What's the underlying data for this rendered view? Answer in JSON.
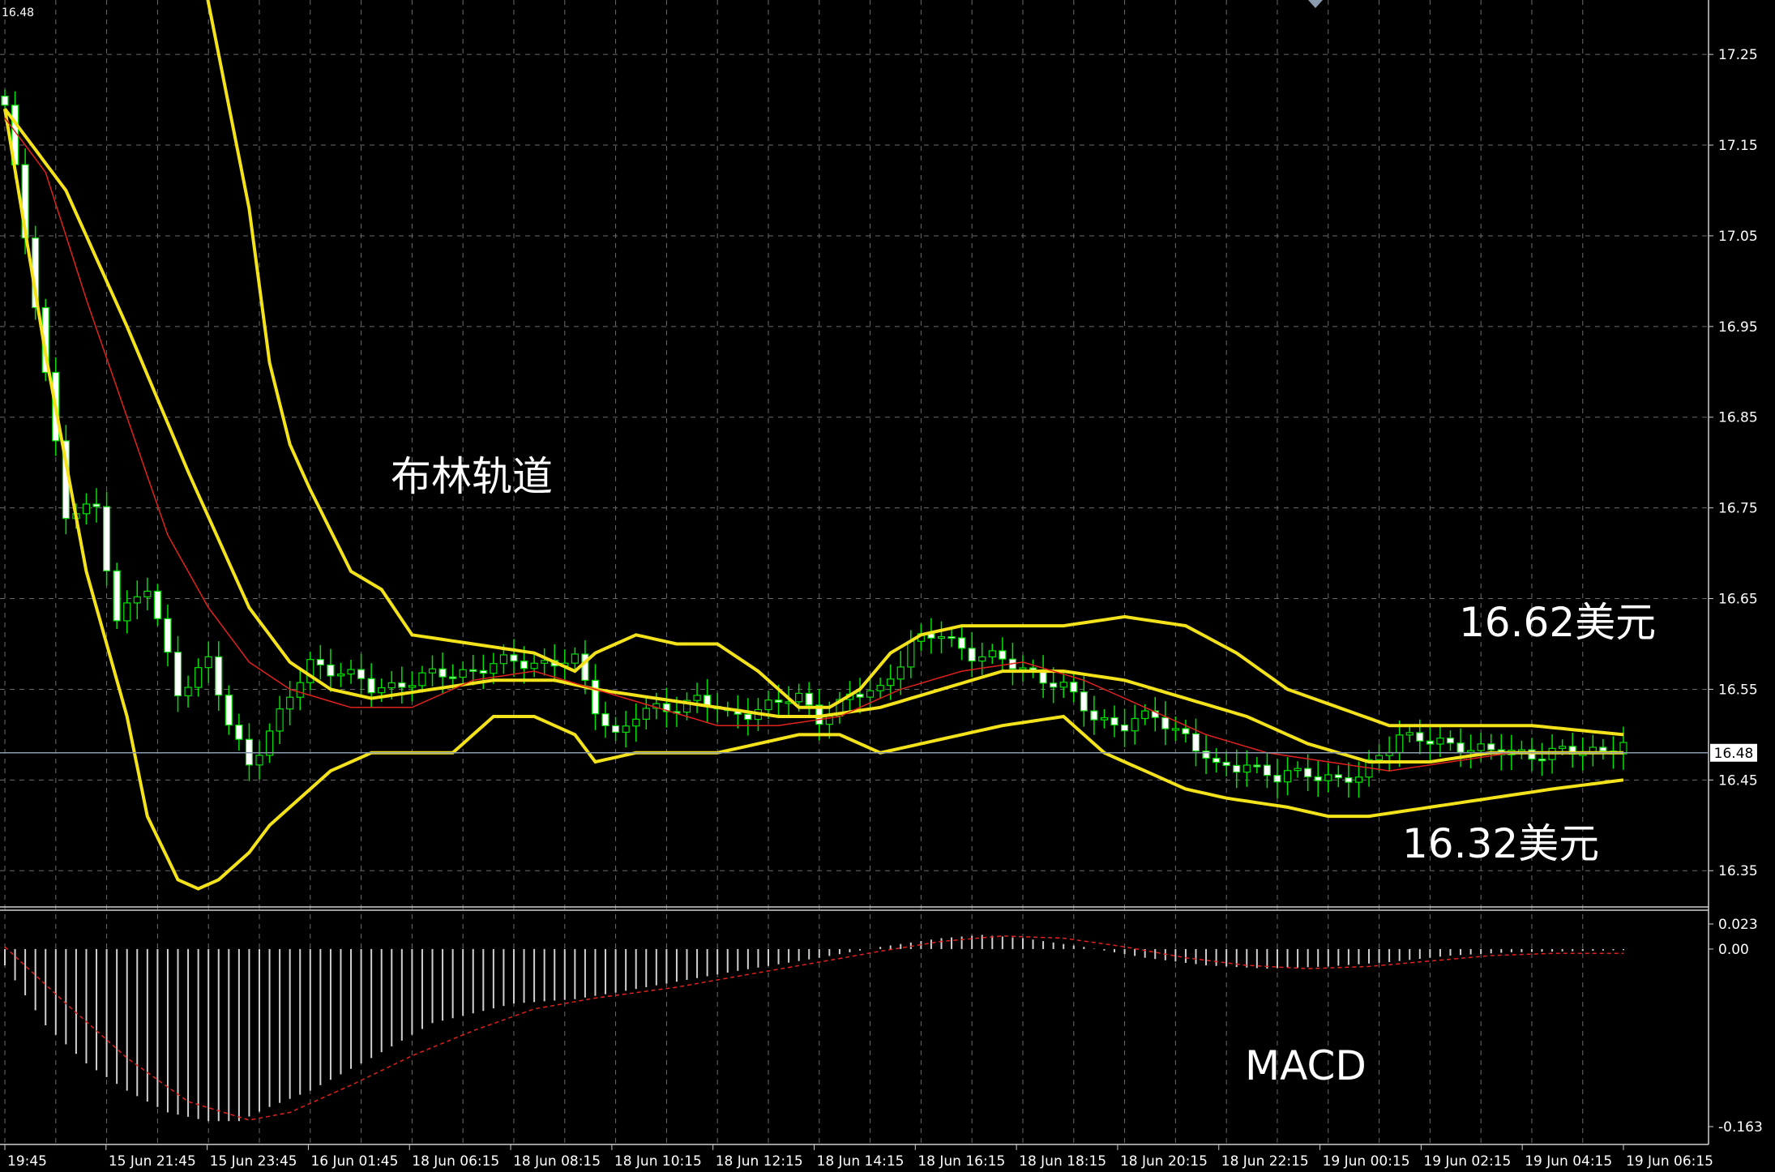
{
  "chart_data": {
    "type": "candlestick",
    "corner_price": "16.48",
    "current_price_label": "16.48",
    "current_price": 16.48,
    "price_axis": {
      "ylim": [
        16.31,
        17.31
      ],
      "ticks": [
        "17.25",
        "17.15",
        "17.05",
        "16.95",
        "16.85",
        "16.75",
        "16.65",
        "16.55",
        "16.45",
        "16.35"
      ],
      "tick_values": [
        17.25,
        17.15,
        17.05,
        16.95,
        16.85,
        16.75,
        16.65,
        16.55,
        16.45,
        16.35
      ]
    },
    "macd_axis": {
      "ylim": [
        -0.163,
        0.023
      ],
      "ticks": [
        "0.023",
        "0.00",
        "-0.163"
      ],
      "tick_values": [
        0.023,
        0.0,
        -0.163
      ]
    },
    "x_ticks": [
      "19:45",
      "15 Jun 21:45",
      "15 Jun 23:45",
      "16 Jun 01:45",
      "18 Jun 06:15",
      "18 Jun 08:15",
      "18 Jun 10:15",
      "18 Jun 12:15",
      "18 Jun 14:15",
      "18 Jun 16:15",
      "18 Jun 18:15",
      "18 Jun 20:15",
      "18 Jun 22:15",
      "19 Jun 00:15",
      "19 Jun 02:15",
      "19 Jun 04:15",
      "19 Jun 06:15"
    ],
    "bars_count": 160,
    "close_anchors": [
      [
        0,
        17.19
      ],
      [
        3,
        16.98
      ],
      [
        6,
        16.74
      ],
      [
        9,
        16.75
      ],
      [
        11,
        16.63
      ],
      [
        14,
        16.66
      ],
      [
        17,
        16.55
      ],
      [
        20,
        16.58
      ],
      [
        22,
        16.51
      ],
      [
        24,
        16.47
      ],
      [
        27,
        16.52
      ],
      [
        30,
        16.58
      ],
      [
        33,
        16.57
      ],
      [
        36,
        16.55
      ],
      [
        40,
        16.56
      ],
      [
        45,
        16.57
      ],
      [
        50,
        16.58
      ],
      [
        56,
        16.58
      ],
      [
        58,
        16.53
      ],
      [
        60,
        16.5
      ],
      [
        62,
        16.52
      ],
      [
        65,
        16.53
      ],
      [
        68,
        16.54
      ],
      [
        71,
        16.52
      ],
      [
        74,
        16.53
      ],
      [
        78,
        16.54
      ],
      [
        80,
        16.52
      ],
      [
        83,
        16.54
      ],
      [
        86,
        16.55
      ],
      [
        89,
        16.6
      ],
      [
        92,
        16.61
      ],
      [
        95,
        16.59
      ],
      [
        98,
        16.58
      ],
      [
        101,
        16.57
      ],
      [
        104,
        16.55
      ],
      [
        107,
        16.52
      ],
      [
        110,
        16.51
      ],
      [
        113,
        16.52
      ],
      [
        116,
        16.5
      ],
      [
        119,
        16.46
      ],
      [
        122,
        16.47
      ],
      [
        125,
        16.45
      ],
      [
        128,
        16.46
      ],
      [
        131,
        16.45
      ],
      [
        133,
        16.45
      ],
      [
        135,
        16.48
      ],
      [
        137,
        16.5
      ],
      [
        140,
        16.49
      ],
      [
        143,
        16.49
      ],
      [
        146,
        16.48
      ],
      [
        150,
        16.48
      ],
      [
        155,
        16.48
      ],
      [
        159,
        16.49
      ]
    ],
    "bollinger_upper_anchors": [
      [
        0,
        17.4
      ],
      [
        10,
        17.5
      ],
      [
        18,
        17.42
      ],
      [
        24,
        17.08
      ],
      [
        26,
        16.91
      ],
      [
        28,
        16.82
      ],
      [
        30,
        16.77
      ],
      [
        34,
        16.68
      ],
      [
        37,
        16.66
      ],
      [
        40,
        16.61
      ],
      [
        46,
        16.6
      ],
      [
        52,
        16.59
      ],
      [
        56,
        16.57
      ],
      [
        58,
        16.59
      ],
      [
        62,
        16.61
      ],
      [
        66,
        16.6
      ],
      [
        70,
        16.6
      ],
      [
        74,
        16.57
      ],
      [
        78,
        16.53
      ],
      [
        81,
        16.53
      ],
      [
        84,
        16.55
      ],
      [
        87,
        16.59
      ],
      [
        90,
        16.61
      ],
      [
        94,
        16.62
      ],
      [
        98,
        16.62
      ],
      [
        104,
        16.62
      ],
      [
        110,
        16.63
      ],
      [
        116,
        16.62
      ],
      [
        121,
        16.59
      ],
      [
        126,
        16.55
      ],
      [
        131,
        16.53
      ],
      [
        136,
        16.51
      ],
      [
        142,
        16.51
      ],
      [
        150,
        16.51
      ],
      [
        159,
        16.5
      ]
    ],
    "bollinger_middle_anchors": [
      [
        0,
        17.19
      ],
      [
        6,
        17.1
      ],
      [
        12,
        16.95
      ],
      [
        18,
        16.79
      ],
      [
        24,
        16.64
      ],
      [
        28,
        16.58
      ],
      [
        32,
        16.55
      ],
      [
        36,
        16.54
      ],
      [
        42,
        16.55
      ],
      [
        48,
        16.56
      ],
      [
        54,
        16.56
      ],
      [
        58,
        16.55
      ],
      [
        64,
        16.54
      ],
      [
        70,
        16.53
      ],
      [
        76,
        16.52
      ],
      [
        80,
        16.52
      ],
      [
        86,
        16.53
      ],
      [
        92,
        16.55
      ],
      [
        98,
        16.57
      ],
      [
        104,
        16.57
      ],
      [
        110,
        16.56
      ],
      [
        116,
        16.54
      ],
      [
        122,
        16.52
      ],
      [
        128,
        16.49
      ],
      [
        134,
        16.47
      ],
      [
        140,
        16.47
      ],
      [
        146,
        16.48
      ],
      [
        152,
        16.48
      ],
      [
        159,
        16.48
      ]
    ],
    "bollinger_lower_anchors": [
      [
        0,
        17.19
      ],
      [
        4,
        16.92
      ],
      [
        8,
        16.68
      ],
      [
        12,
        16.52
      ],
      [
        14,
        16.41
      ],
      [
        17,
        16.34
      ],
      [
        19,
        16.33
      ],
      [
        21,
        16.34
      ],
      [
        24,
        16.37
      ],
      [
        26,
        16.4
      ],
      [
        28,
        16.42
      ],
      [
        30,
        16.44
      ],
      [
        32,
        16.46
      ],
      [
        36,
        16.48
      ],
      [
        40,
        16.48
      ],
      [
        44,
        16.48
      ],
      [
        48,
        16.52
      ],
      [
        52,
        16.52
      ],
      [
        56,
        16.5
      ],
      [
        58,
        16.47
      ],
      [
        62,
        16.48
      ],
      [
        66,
        16.48
      ],
      [
        70,
        16.48
      ],
      [
        74,
        16.49
      ],
      [
        78,
        16.5
      ],
      [
        82,
        16.5
      ],
      [
        86,
        16.48
      ],
      [
        90,
        16.49
      ],
      [
        94,
        16.5
      ],
      [
        98,
        16.51
      ],
      [
        104,
        16.52
      ],
      [
        108,
        16.48
      ],
      [
        112,
        16.46
      ],
      [
        116,
        16.44
      ],
      [
        120,
        16.43
      ],
      [
        126,
        16.42
      ],
      [
        130,
        16.41
      ],
      [
        134,
        16.41
      ],
      [
        140,
        16.42
      ],
      [
        146,
        16.43
      ],
      [
        152,
        16.44
      ],
      [
        159,
        16.45
      ]
    ],
    "ma_anchors": [
      [
        0,
        17.18
      ],
      [
        4,
        17.12
      ],
      [
        8,
        16.98
      ],
      [
        12,
        16.85
      ],
      [
        16,
        16.72
      ],
      [
        20,
        16.64
      ],
      [
        24,
        16.58
      ],
      [
        28,
        16.55
      ],
      [
        34,
        16.53
      ],
      [
        40,
        16.53
      ],
      [
        46,
        16.56
      ],
      [
        52,
        16.57
      ],
      [
        58,
        16.55
      ],
      [
        64,
        16.53
      ],
      [
        70,
        16.51
      ],
      [
        76,
        16.51
      ],
      [
        82,
        16.52
      ],
      [
        88,
        16.55
      ],
      [
        94,
        16.57
      ],
      [
        100,
        16.58
      ],
      [
        106,
        16.56
      ],
      [
        112,
        16.53
      ],
      [
        118,
        16.5
      ],
      [
        124,
        16.48
      ],
      [
        130,
        16.47
      ],
      [
        136,
        16.46
      ],
      [
        142,
        16.47
      ],
      [
        148,
        16.48
      ],
      [
        154,
        16.48
      ],
      [
        159,
        16.48
      ]
    ],
    "macd_hist_anchors": [
      [
        0,
        -0.015
      ],
      [
        4,
        -0.07
      ],
      [
        8,
        -0.105
      ],
      [
        12,
        -0.13
      ],
      [
        16,
        -0.15
      ],
      [
        20,
        -0.158
      ],
      [
        23,
        -0.158
      ],
      [
        26,
        -0.145
      ],
      [
        30,
        -0.13
      ],
      [
        36,
        -0.1
      ],
      [
        42,
        -0.068
      ],
      [
        50,
        -0.05
      ],
      [
        56,
        -0.046
      ],
      [
        60,
        -0.04
      ],
      [
        66,
        -0.03
      ],
      [
        72,
        -0.02
      ],
      [
        80,
        -0.008
      ],
      [
        86,
        0.002
      ],
      [
        92,
        0.01
      ],
      [
        96,
        0.013
      ],
      [
        100,
        0.01
      ],
      [
        106,
        0.002
      ],
      [
        112,
        -0.008
      ],
      [
        118,
        -0.015
      ],
      [
        124,
        -0.018
      ],
      [
        130,
        -0.016
      ],
      [
        136,
        -0.012
      ],
      [
        142,
        -0.006
      ],
      [
        148,
        -0.003
      ],
      [
        154,
        -0.002
      ],
      [
        159,
        -0.001
      ]
    ],
    "macd_signal_anchors": [
      [
        0,
        0.002
      ],
      [
        6,
        -0.05
      ],
      [
        12,
        -0.1
      ],
      [
        18,
        -0.14
      ],
      [
        24,
        -0.157
      ],
      [
        28,
        -0.15
      ],
      [
        34,
        -0.125
      ],
      [
        40,
        -0.098
      ],
      [
        46,
        -0.075
      ],
      [
        52,
        -0.055
      ],
      [
        58,
        -0.045
      ],
      [
        66,
        -0.035
      ],
      [
        72,
        -0.025
      ],
      [
        80,
        -0.012
      ],
      [
        86,
        -0.002
      ],
      [
        92,
        0.007
      ],
      [
        98,
        0.012
      ],
      [
        104,
        0.01
      ],
      [
        110,
        0.002
      ],
      [
        116,
        -0.008
      ],
      [
        122,
        -0.015
      ],
      [
        128,
        -0.018
      ],
      [
        134,
        -0.016
      ],
      [
        140,
        -0.011
      ],
      [
        146,
        -0.006
      ],
      [
        152,
        -0.004
      ],
      [
        159,
        -0.004
      ]
    ],
    "annotations": [
      {
        "id": "bollinger",
        "text": "布林轨道"
      },
      {
        "id": "upper",
        "text": "16.62美元"
      },
      {
        "id": "lower",
        "text": "16.32美元"
      },
      {
        "id": "macd",
        "text": "MACD"
      }
    ],
    "colors": {
      "background": "#000000",
      "grid": "#6b6b6b",
      "bollinger": "#f4e31a",
      "moving_average": "#e0221c",
      "candle_up": "#00e000",
      "candle_down": "#ffffff",
      "macd_histogram": "#d0d0d0",
      "macd_signal": "#e0221c",
      "price_line": "#8a9bb0"
    }
  }
}
